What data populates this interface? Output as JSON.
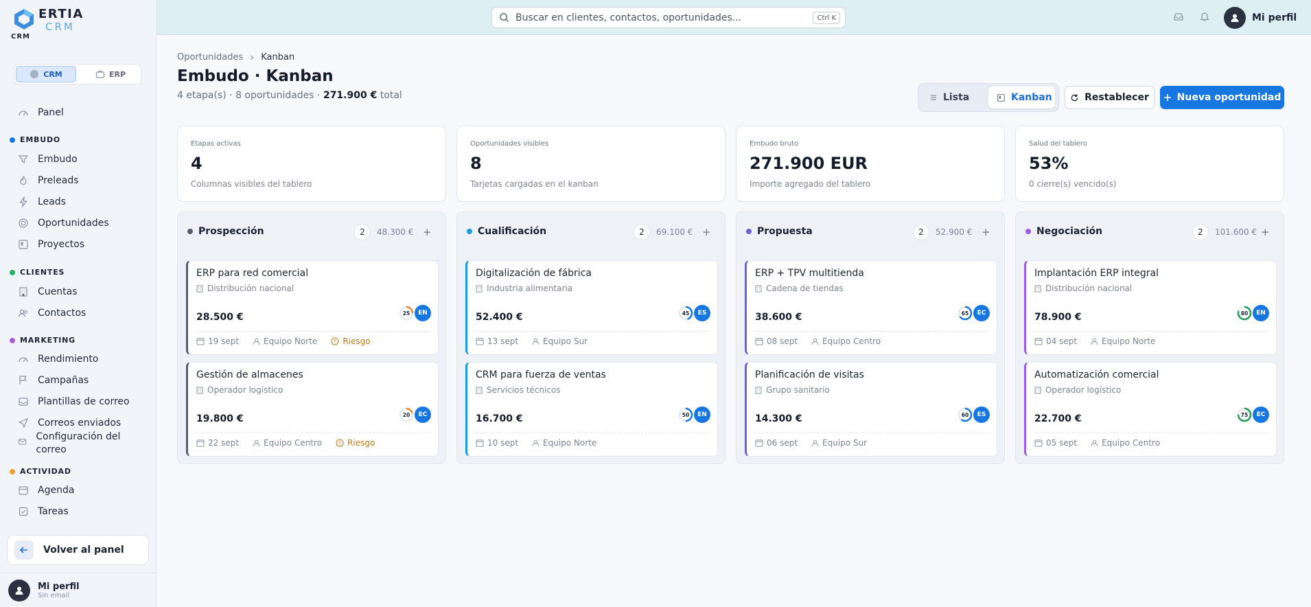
{
  "brand": {
    "name_main": "ERTIA",
    "name_sub": "CRM",
    "module": "CRM"
  },
  "switcher": {
    "crm": "CRM",
    "erp": "ERP"
  },
  "sidebar": {
    "panel": "Panel",
    "sections": [
      {
        "title": "EMBUDO",
        "color": "#1677e0",
        "items": [
          "Embudo",
          "Preleads",
          "Leads",
          "Oportunidades",
          "Proyectos"
        ]
      },
      {
        "title": "CLIENTES",
        "color": "#22b35e",
        "items": [
          "Cuentas",
          "Contactos"
        ]
      },
      {
        "title": "MARKETING",
        "color": "#a85bdc",
        "items": [
          "Rendimiento",
          "Campañas",
          "Plantillas de correo",
          "Correos enviados",
          "Configuración del correo"
        ]
      },
      {
        "title": "ACTIVIDAD",
        "color": "#f0a030",
        "items": [
          "Agenda",
          "Tareas"
        ]
      }
    ],
    "back_label": "Volver al panel",
    "profile_name": "Mi perfil",
    "profile_email": "Sin email"
  },
  "topbar": {
    "search_placeholder": "Buscar en clientes, contactos, oportunidades...",
    "shortcut": "Ctrl K",
    "profile_label": "Mi perfil"
  },
  "breadcrumb": {
    "parent": "Oportunidades",
    "current": "Kanban"
  },
  "page": {
    "title": "Embudo · Kanban",
    "summary": "4 etapa(s) · 8 oportunidades ·",
    "total_amount": "271.900 €",
    "total_suffix": "total"
  },
  "toolbar": {
    "list_label": "Lista",
    "kanban_label": "Kanban",
    "reset_label": "Restablecer",
    "new_label": "Nueva oportunidad"
  },
  "stats": [
    {
      "label": "Etapas activas",
      "value": "4",
      "desc": "Columnas visibles del tablero"
    },
    {
      "label": "Oportunidades visibles",
      "value": "8",
      "desc": "Tarjetas cargadas en el kanban"
    },
    {
      "label": "Embudo bruto",
      "value": "271.900 EUR",
      "desc": "Importe agregado del tablero"
    },
    {
      "label": "Salud del tablero",
      "value": "53%",
      "desc": "0 cierre(s) vencido(s)"
    }
  ],
  "columns": [
    {
      "name": "Prospección",
      "count": "2",
      "total": "48.300 €",
      "add": "+",
      "color": "#555c6b",
      "cards": [
        {
          "title": "ERP para red comercial",
          "org": "Distribución nacional",
          "amount": "28.500 €",
          "progress": 25,
          "ring_color": "#e88a2a",
          "owner": "EN",
          "date": "19 sept",
          "team": "Equipo Norte",
          "risk": "Riesgo"
        },
        {
          "title": "Gestión de almacenes",
          "org": "Operador logístico",
          "amount": "19.800 €",
          "progress": 20,
          "ring_color": "#e88a2a",
          "owner": "EC",
          "date": "22 sept",
          "team": "Equipo Centro",
          "risk": "Riesgo"
        }
      ]
    },
    {
      "name": "Cualificación",
      "count": "2",
      "total": "69.100 €",
      "add": "+",
      "color": "#1a9bd7",
      "cards": [
        {
          "title": "Digitalización de fábrica",
          "org": "Industria alimentaria",
          "amount": "52.400 €",
          "progress": 45,
          "ring_color": "#1677e0",
          "owner": "ES",
          "date": "13 sept",
          "team": "Equipo Sur",
          "risk": ""
        },
        {
          "title": "CRM para fuerza de ventas",
          "org": "Servicios técnicos",
          "amount": "16.700 €",
          "progress": 50,
          "ring_color": "#1677e0",
          "owner": "EN",
          "date": "10 sept",
          "team": "Equipo Norte",
          "risk": ""
        }
      ]
    },
    {
      "name": "Propuesta",
      "count": "2",
      "total": "52.900 €",
      "add": "+",
      "color": "#6a5fd8",
      "cards": [
        {
          "title": "ERP + TPV multitienda",
          "org": "Cadena de tiendas",
          "amount": "38.600 €",
          "progress": 65,
          "ring_color": "#1677e0",
          "owner": "EC",
          "date": "08 sept",
          "team": "Equipo Centro",
          "risk": ""
        },
        {
          "title": "Planificación de visitas",
          "org": "Grupo sanitario",
          "amount": "14.300 €",
          "progress": 60,
          "ring_color": "#1677e0",
          "owner": "ES",
          "date": "06 sept",
          "team": "Equipo Sur",
          "risk": ""
        }
      ]
    },
    {
      "name": "Negociación",
      "count": "2",
      "total": "101.600 €",
      "add": "+",
      "color": "#9a5ce0",
      "cards": [
        {
          "title": "Implantación ERP integral",
          "org": "Distribución nacional",
          "amount": "78.900 €",
          "progress": 80,
          "ring_color": "#1f9a55",
          "owner": "EN",
          "date": "04 sept",
          "team": "Equipo Norte",
          "risk": ""
        },
        {
          "title": "Automatización comercial",
          "org": "Operador logístico",
          "amount": "22.700 €",
          "progress": 75,
          "ring_color": "#1f9a55",
          "owner": "EC",
          "date": "05 sept",
          "team": "Equipo Centro",
          "risk": ""
        }
      ]
    }
  ]
}
